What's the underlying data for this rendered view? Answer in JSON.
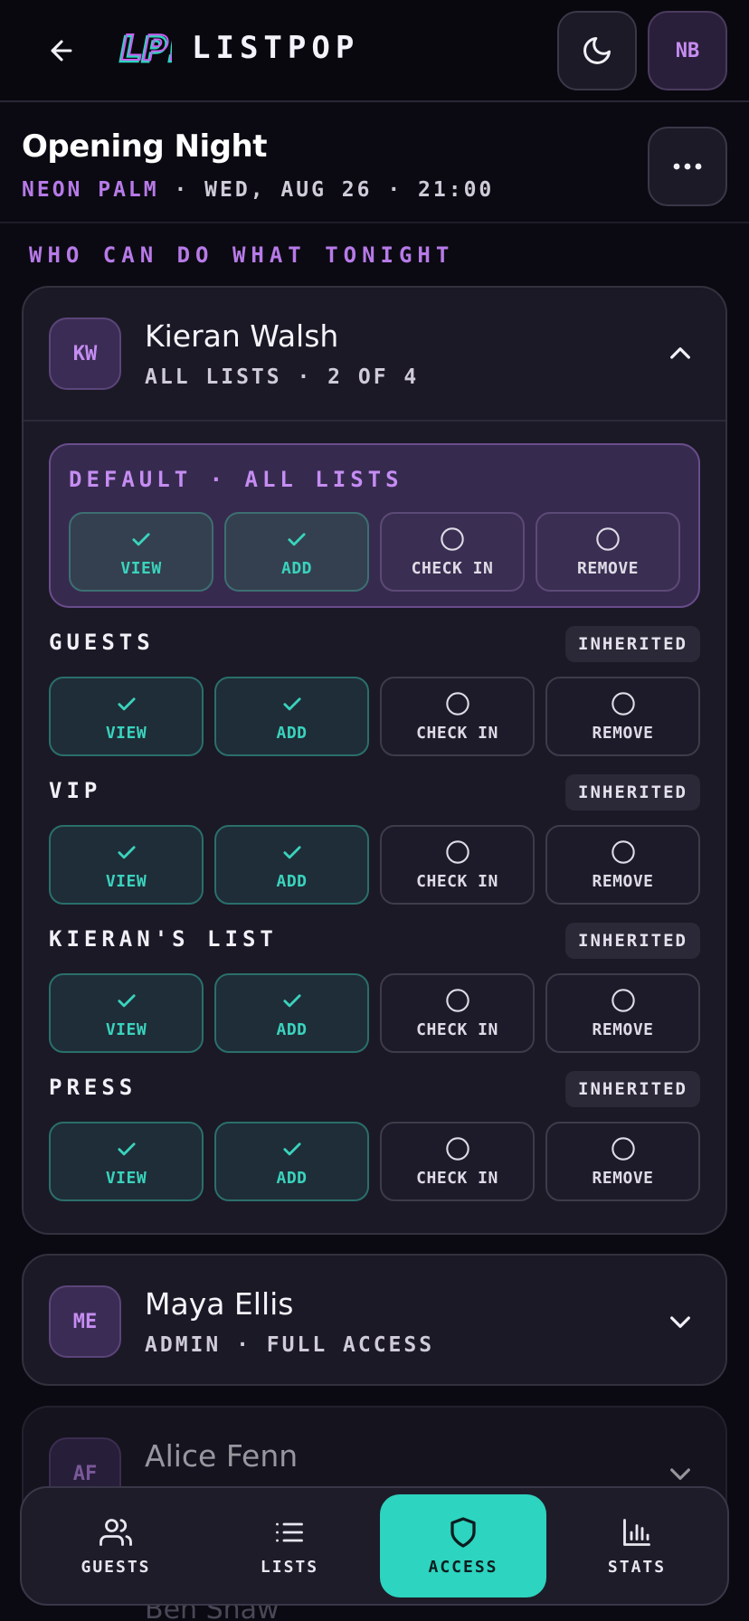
{
  "header": {
    "brand": "LISTPOP",
    "profile_initials": "NB"
  },
  "event": {
    "title": "Opening Night",
    "venue": "NEON PALM",
    "details": " · WED, AUG 26 · 21:00"
  },
  "section_label": "WHO CAN DO WHAT TONIGHT",
  "permission_labels": [
    "VIEW",
    "ADD",
    "CHECK IN",
    "REMOVE"
  ],
  "people": [
    {
      "initials": "KW",
      "name": "Kieran Walsh",
      "subtitle": "ALL LISTS · 2 OF 4",
      "expanded": true,
      "default": {
        "label": "DEFAULT · ALL LISTS",
        "permissions": [
          true,
          true,
          false,
          false
        ]
      },
      "lists": [
        {
          "name": "GUESTS",
          "badge": "INHERITED",
          "permissions": [
            true,
            true,
            false,
            false
          ]
        },
        {
          "name": "VIP",
          "badge": "INHERITED",
          "permissions": [
            true,
            true,
            false,
            false
          ]
        },
        {
          "name": "KIERAN'S LIST",
          "badge": "INHERITED",
          "permissions": [
            true,
            true,
            false,
            false
          ]
        },
        {
          "name": "PRESS",
          "badge": "INHERITED",
          "permissions": [
            true,
            true,
            false,
            false
          ]
        }
      ]
    },
    {
      "initials": "ME",
      "name": "Maya Ellis",
      "subtitle": "ADMIN · FULL ACCESS",
      "expanded": false
    },
    {
      "initials": "AF",
      "name": "Alice Fenn",
      "subtitle": "",
      "expanded": false
    }
  ],
  "partial_next_name": "Ben Shaw",
  "nav": {
    "items": [
      {
        "label": "GUESTS",
        "icon": "users-icon"
      },
      {
        "label": "LISTS",
        "icon": "list-icon"
      },
      {
        "label": "ACCESS",
        "icon": "shield-icon"
      },
      {
        "label": "STATS",
        "icon": "bar-chart-icon"
      }
    ],
    "active": "ACCESS"
  },
  "colors": {
    "accent_purple": "#b77ae8",
    "accent_teal": "#2dd4bf",
    "background": "#0b0a12"
  }
}
